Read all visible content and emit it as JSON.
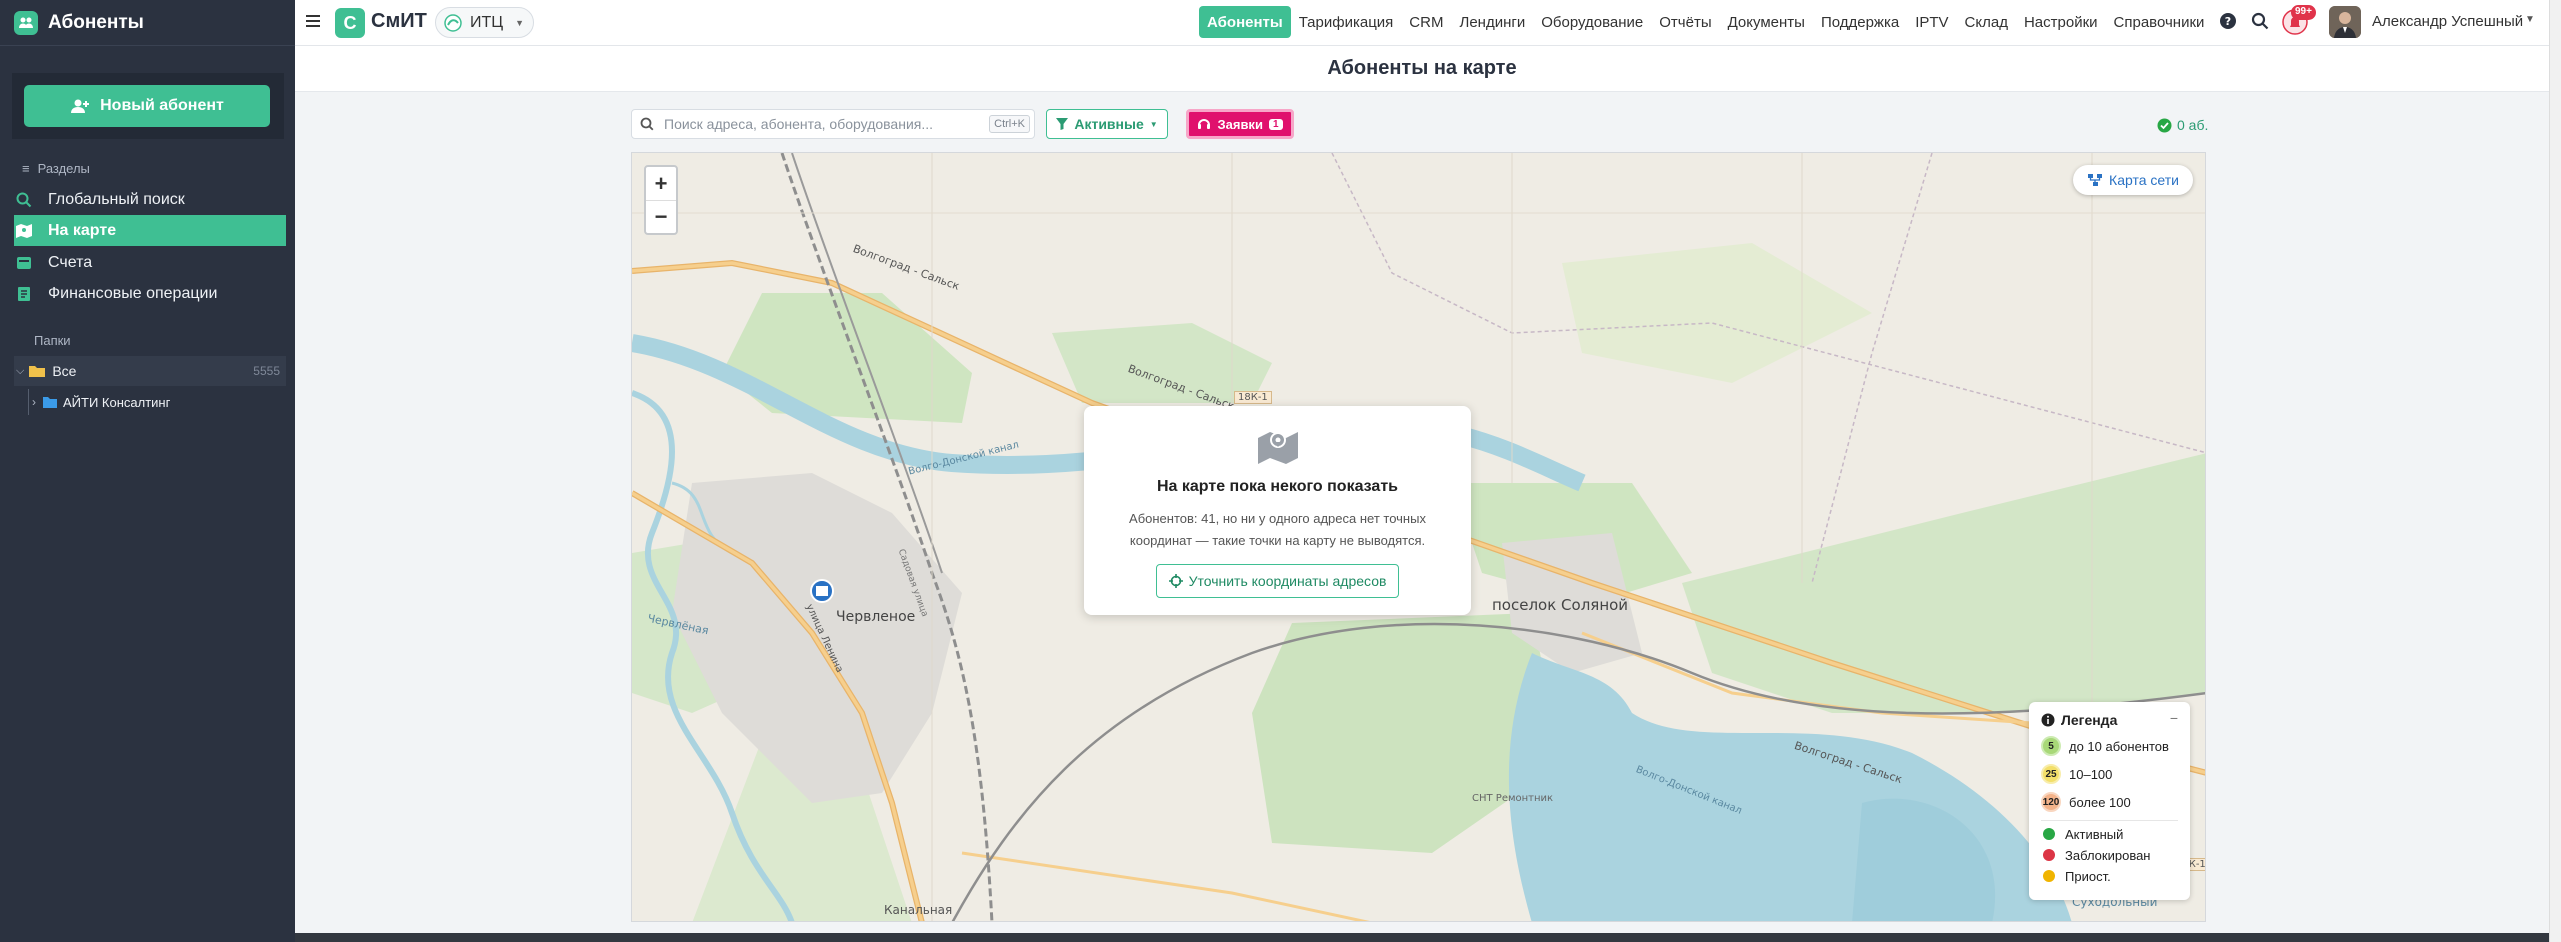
{
  "sidebar": {
    "title": "Абоненты",
    "new_button": "Новый абонент",
    "sections_label": "Разделы",
    "nav": [
      {
        "label": "Глобальный поиск",
        "icon": "search-icon"
      },
      {
        "label": "На карте",
        "icon": "map-users-icon",
        "active": true
      },
      {
        "label": "Счета",
        "icon": "invoice-icon"
      },
      {
        "label": "Финансовые операции",
        "icon": "finance-icon"
      }
    ],
    "folders_label": "Папки",
    "folders": [
      {
        "label": "Все",
        "count": "5555"
      },
      {
        "label": "АЙТИ Консалтинг"
      }
    ]
  },
  "topbar": {
    "brand_letter": "С",
    "brand": "СмИТ",
    "org": "ИТЦ",
    "menu": [
      "Абоненты",
      "Тарификация",
      "CRM",
      "Лендинги",
      "Оборудование",
      "Отчёты",
      "Документы",
      "Поддержка",
      "IPTV",
      "Склад",
      "Настройки",
      "Справочники"
    ],
    "active_menu": "Абоненты",
    "notifications_badge": "99+",
    "user_name": "Александр Успешный"
  },
  "main": {
    "page_title": "Абоненты на карте",
    "search_placeholder": "Поиск адреса, абонента, оборудования...",
    "search_shortcut": "Ctrl+K",
    "filter_label": "Активные",
    "orders_label": "Заявки",
    "orders_count": "1",
    "subscribers_count": "0 аб."
  },
  "map": {
    "network_button": "Карта сети",
    "empty_title": "На карте пока некого показать",
    "empty_text": "Абонентов: 41, но ни у одного адреса нет точных координат — такие точки на карту не выводятся.",
    "fix_button": "Уточнить координаты адресов",
    "labels": {
      "road1": "Волгоград - Сальск",
      "road2": "Волгоград - Сальск",
      "road3": "Волгоград - Сальск",
      "road_code1": "18К-1",
      "road_code2": "18К-1",
      "canal": "Волго-Донской канал",
      "chervlenoe": "Червленое",
      "chervlenaya": "Червлёная",
      "posyolok": "поселок Соляной",
      "lenina": "улица Ленина",
      "kanalnaya": "Канальная",
      "snt": "СНТ Ремонтник",
      "canal2": "Волго-Донской канал",
      "sukhodol": "Суходольный",
      "sadovaya": "Садовая улица"
    },
    "legend": {
      "title": "Легенда",
      "collapse": "−",
      "sizes": [
        {
          "num": "5",
          "label": "до 10 абонентов",
          "color": "#a8d878"
        },
        {
          "num": "25",
          "label": "10–100",
          "color": "#f3df6a"
        },
        {
          "num": "120",
          "label": "более 100",
          "color": "#f4b38a"
        }
      ],
      "statuses": [
        {
          "label": "Активный",
          "color": "#28a745"
        },
        {
          "label": "Заблокирован",
          "color": "#dc3545"
        },
        {
          "label": "Приост.",
          "color": "#f0b400"
        }
      ]
    }
  },
  "colors": {
    "accent": "#3fbf93",
    "sidebar_bg": "#2b3240",
    "orders": "#e0116d"
  }
}
